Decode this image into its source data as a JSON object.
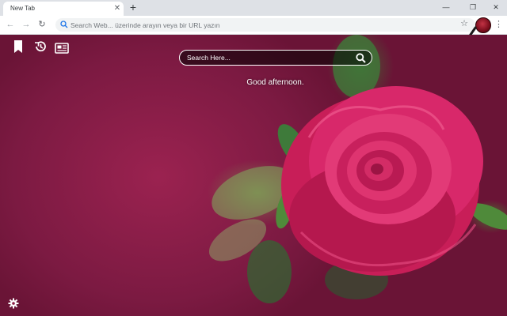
{
  "tab": {
    "title": "New Tab",
    "close": "✕",
    "new": "+"
  },
  "window": {
    "minimize": "—",
    "maximize": "❐",
    "close": "✕"
  },
  "toolbar": {
    "back": "←",
    "forward": "→",
    "reload": "↻",
    "omnibox_placeholder": "Search Web... üzerinde arayın veya bir URL yazın",
    "star": "☆",
    "menu": "⋮"
  },
  "page": {
    "search_placeholder": "Search Here...",
    "greeting": "Good afternoon."
  },
  "icons": {
    "bookmark": "bookmark-icon",
    "history": "history-icon",
    "news": "news-icon",
    "settings": "gear-icon",
    "search": "search-icon",
    "extension": "magnifier-extension-icon"
  },
  "colors": {
    "background": "#8a1d45",
    "rose": "#d6275e",
    "leaf": "#4f8a3a",
    "toolbar": "#ffffff",
    "tabstrip": "#dee1e6"
  }
}
